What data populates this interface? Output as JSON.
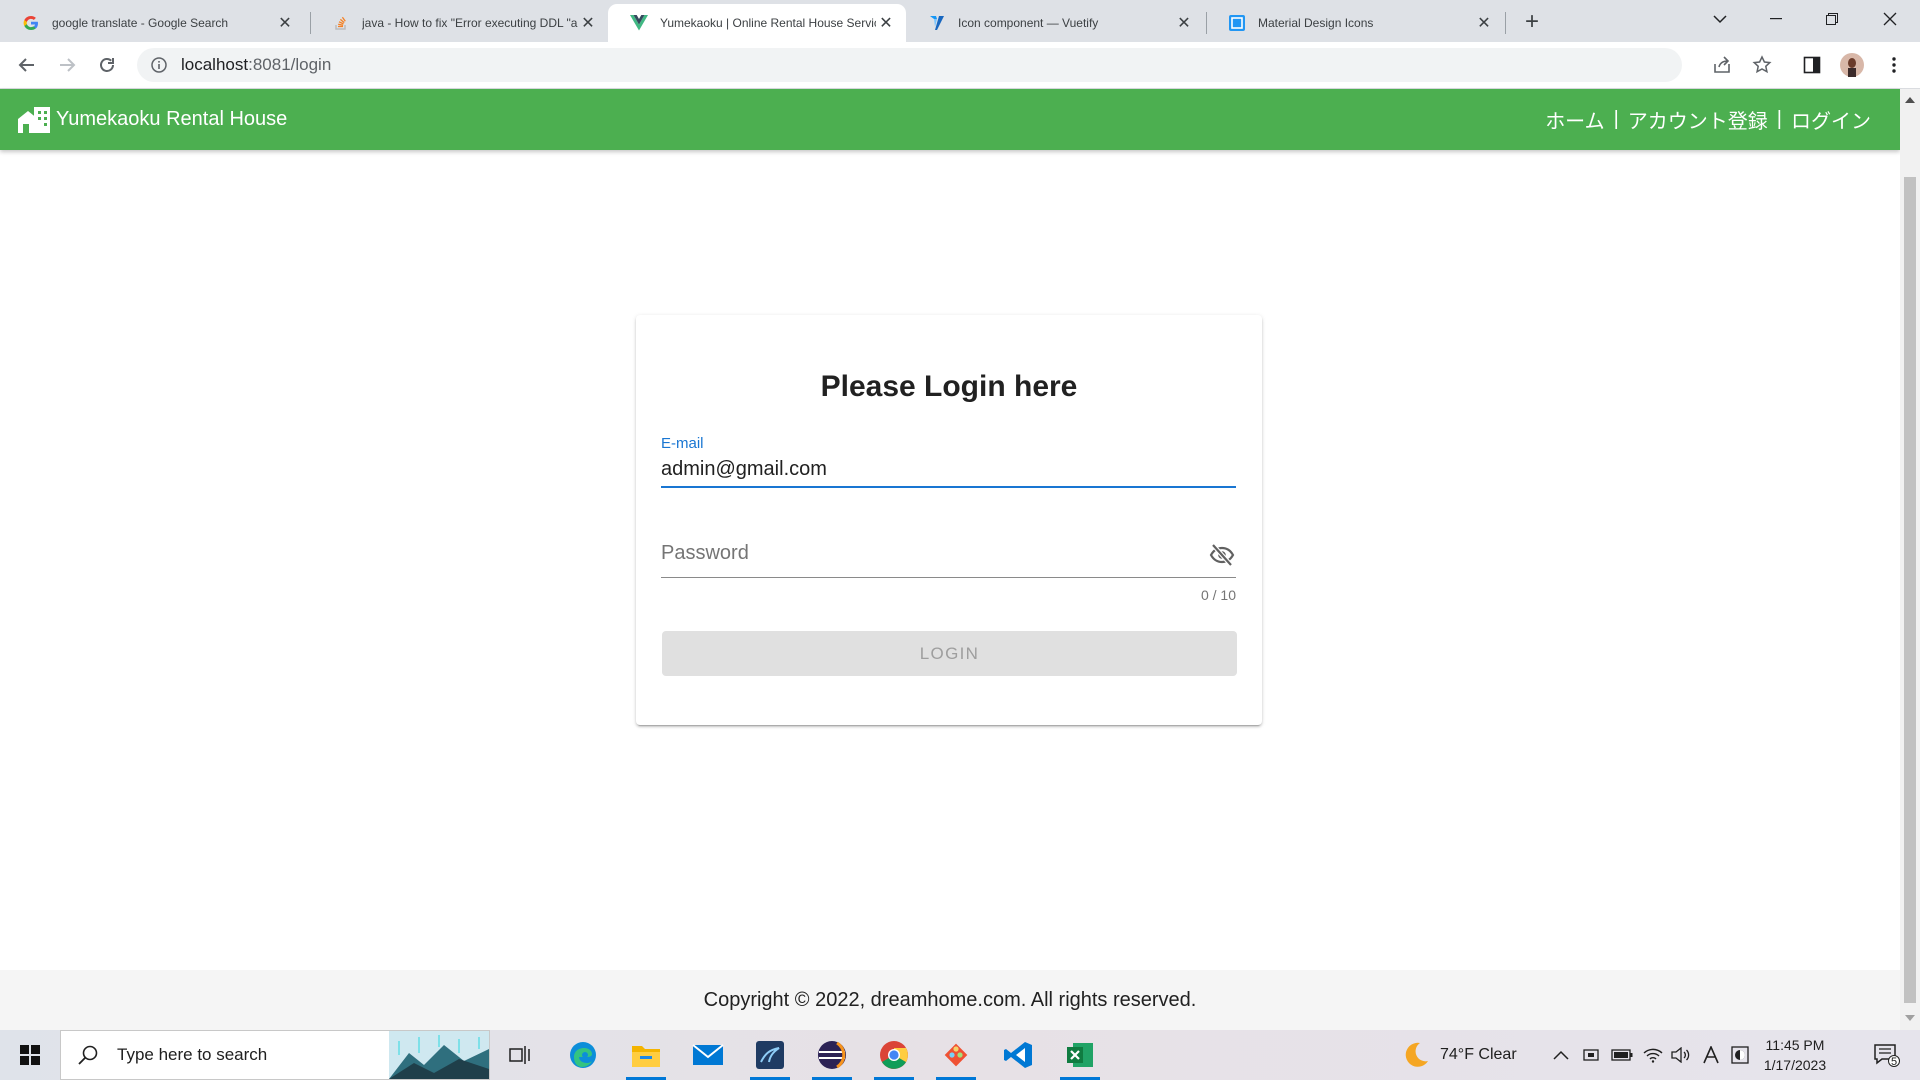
{
  "browser": {
    "tabs": [
      {
        "title": "google translate - Google Search",
        "icon": "google-icon",
        "active": false
      },
      {
        "title": "java - How to fix \"Error executing DDL \"alter",
        "icon": "stackoverflow-icon",
        "active": false
      },
      {
        "title": "Yumekaoku | Online Rental House Service",
        "icon": "vue-icon",
        "active": true
      },
      {
        "title": "Icon component — Vuetify",
        "icon": "vuetify-icon",
        "active": false
      },
      {
        "title": "Material Design Icons",
        "icon": "mdi-icon",
        "active": false
      }
    ],
    "url_host": "localhost",
    "url_path": ":8081/login"
  },
  "app": {
    "brand": "Yumekaoku Rental House",
    "nav": {
      "home": "ホーム",
      "register": "アカウント登録",
      "login": "ログイン",
      "separator": "|"
    },
    "colors": {
      "appbar": "#4caf50",
      "primary": "#1976d2"
    }
  },
  "login": {
    "heading": "Please Login here",
    "email_label": "E-mail",
    "email_value": "admin@gmail.com",
    "password_placeholder": "Password",
    "password_counter": "0 / 10",
    "button_label": "LOGIN"
  },
  "footer": {
    "copyright": "Copyright © 2022, dreamhome.com. All rights reserved."
  },
  "taskbar": {
    "search_placeholder": "Type here to search",
    "weather": "74°F  Clear",
    "time": "11:45 PM",
    "date": "1/17/2023",
    "notification_count": "5",
    "apps": [
      "task-view-icon",
      "edge-icon",
      "file-explorer-icon",
      "mail-icon",
      "app-icon",
      "eclipse-icon",
      "chrome-icon",
      "git-icon",
      "vscode-icon",
      "excel-icon"
    ]
  }
}
